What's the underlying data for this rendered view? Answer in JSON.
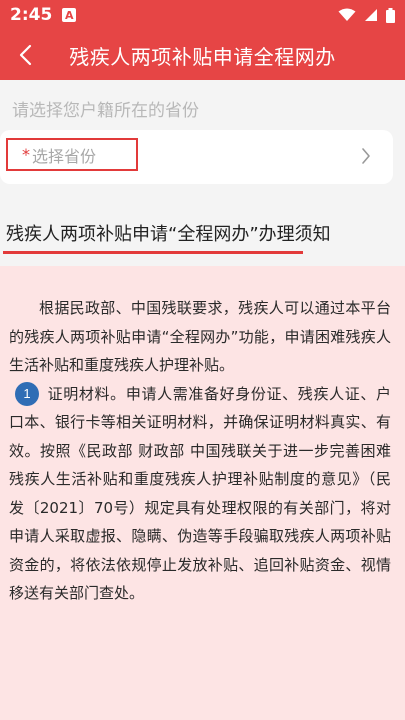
{
  "status_bar": {
    "time": "2:45",
    "notification_letter": "A"
  },
  "nav": {
    "title": "残疾人两项补贴申请全程网办"
  },
  "province": {
    "hint": "请选择您户籍所在的省份",
    "required_mark": "*",
    "placeholder": "选择省份"
  },
  "notice": {
    "title": "残疾人两项补贴申请“全程网办”办理须知",
    "intro": "根据民政部、中国残联要求，残疾人可以通过本平台的残疾人两项补贴申请“全程网办”功能，申请困难残疾人生活补贴和重度残疾人护理补贴。",
    "item_number": "1",
    "item_text": "证明材料。申请人需准备好身份证、残疾人证、户口本、银行卡等相关证明材料，并确保证明材料真实、有效。按照《民政部 财政部 中国残联关于进一步完善困难残疾人生活补贴和重度残疾人护理补贴制度的意见》（民发〔2021〕70号）规定具有处理权限的有关部门，将对申请人采取虚报、隐瞒、伪造等手段骗取残疾人两项补贴资金的，将依法依规停止发放补贴、追回补贴资金、视情移送有关部门查处。"
  },
  "colors": {
    "brand_red": "#e64545",
    "notice_bg": "#fde4e4",
    "badge_blue": "#2f6db5"
  }
}
